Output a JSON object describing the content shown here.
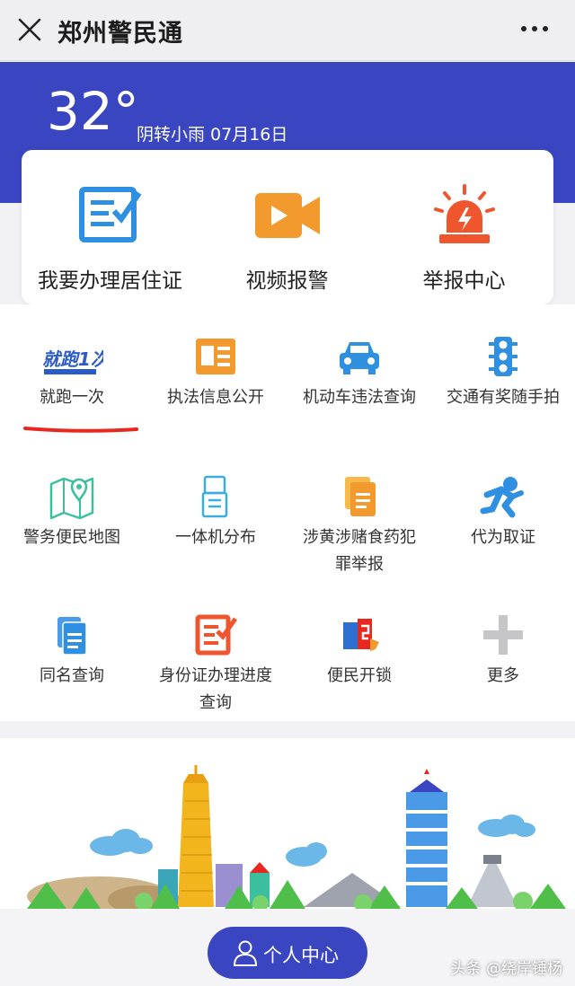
{
  "header": {
    "title": "郑州警民通"
  },
  "hero": {
    "temperature": "32°",
    "weather": "阴转小雨 07月16日"
  },
  "quick_actions": [
    {
      "label": "我要办理居住证",
      "icon": "residence-permit-icon"
    },
    {
      "label": "视频报警",
      "icon": "video-camera-icon"
    },
    {
      "label": "举报中心",
      "icon": "alarm-siren-icon"
    }
  ],
  "services": [
    {
      "label": "就跑一次",
      "icon": "run-once-logo-icon",
      "logo_text": "就跑1次"
    },
    {
      "label": "执法信息公开",
      "icon": "id-card-icon"
    },
    {
      "label": "机动车违法查询",
      "icon": "car-icon"
    },
    {
      "label": "交通有奖随手拍",
      "icon": "traffic-light-icon"
    },
    {
      "label": "警务便民地图",
      "icon": "map-pin-icon"
    },
    {
      "label": "一体机分布",
      "icon": "kiosk-icon"
    },
    {
      "label": "涉黄涉赌食药犯罪举报",
      "icon": "report-document-icon"
    },
    {
      "label": "代为取证",
      "icon": "runner-icon"
    },
    {
      "label": "同名查询",
      "icon": "documents-icon"
    },
    {
      "label": "身份证办理进度查询",
      "icon": "edit-form-icon"
    },
    {
      "label": "便民开锁",
      "icon": "unlock-icon"
    },
    {
      "label": "更多",
      "icon": "plus-icon"
    }
  ],
  "footer": {
    "personal_center": "个人中心"
  },
  "watermark": "头条 @绕岸锤杨",
  "colors": {
    "brand": "#3a45c2",
    "accent_orange": "#f29a2e",
    "accent_blue": "#2f8fe0",
    "underline_red": "#e8281f"
  }
}
